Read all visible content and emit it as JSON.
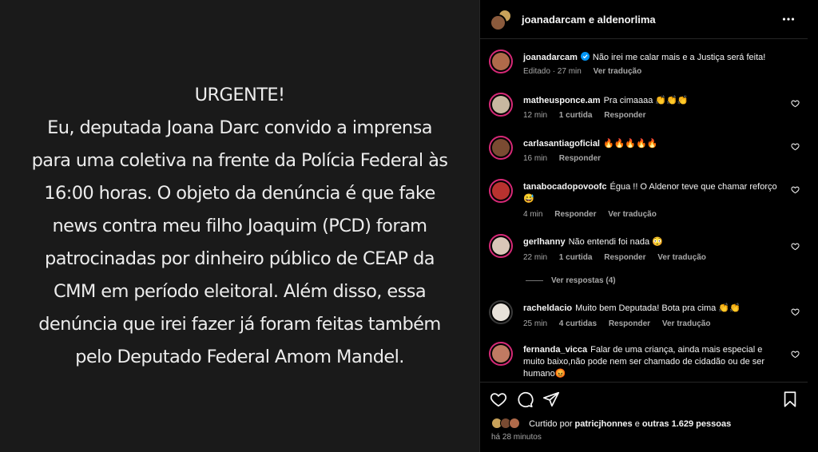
{
  "post": {
    "lines": [
      "URGENTE!",
      "Eu, deputada Joana Darc convido a imprensa",
      "para uma coletiva na frente da Polícia Federal às",
      "16:00 horas. O objeto da denúncia é que fake",
      "news contra meu filho Joaquim (PCD) foram",
      "patrocinadas por dinheiro público de CEAP da",
      "CMM em período eleitoral. Além disso, essa",
      "denúncia que irei fazer já foram feitas também",
      "pelo Deputado Federal Amom Mandel."
    ]
  },
  "header": {
    "title": "joanadarcam e aldenorlima",
    "more_icon": "more-horizontal-icon"
  },
  "caption": {
    "user": "joanadarcam",
    "text": "Não irei me calar mais e a Justiça será feita!",
    "edited": "Editado · 27 min",
    "translate": "Ver tradução"
  },
  "comments": [
    {
      "user": "matheusponce.am",
      "text": "Pra cimaaaa 👏👏👏",
      "time": "12 min",
      "likes": "1 curtida",
      "reply": "Responder",
      "translate": ""
    },
    {
      "user": "carlasantiagoficial",
      "text": "🔥🔥🔥🔥🔥",
      "time": "16 min",
      "likes": "",
      "reply": "Responder",
      "translate": ""
    },
    {
      "user": "tanabocadopovoofc",
      "text": "Égua !! O Aldenor teve que chamar reforço 😅",
      "time": "4 min",
      "likes": "",
      "reply": "Responder",
      "translate": "Ver tradução"
    },
    {
      "user": "gerlhanny",
      "text": "Não entendi foi nada 😳",
      "time": "22 min",
      "likes": "1 curtida",
      "reply": "Responder",
      "translate": "Ver tradução"
    },
    {
      "user": "racheldacio",
      "text": "Muito bem Deputada! Bota pra cima 👏👏",
      "time": "25 min",
      "likes": "4 curtidas",
      "reply": "Responder",
      "translate": "Ver tradução"
    },
    {
      "user": "fernanda_vicca",
      "text": "Falar de uma criança, ainda mais especial e muito baixo,não pode nem ser chamado de cidadão ou de ser humano😡",
      "time": "",
      "likes": "",
      "reply": "",
      "translate": ""
    }
  ],
  "view_replies": "Ver respostas (4)",
  "likes": {
    "prefix": "Curtido por",
    "user": "patricjhonnes",
    "mid": "e",
    "others": "outras 1.629 pessoas"
  },
  "time_ago": "há 28 minutos",
  "icons": {
    "like": "heart-icon",
    "comment": "comment-icon",
    "share": "share-icon",
    "save": "bookmark-icon"
  },
  "colors": {
    "background": "#000000",
    "post_bg": "#1a1a1a",
    "muted": "#a8a8a8",
    "story_ring": "#d62976",
    "verified": "#0095f6"
  }
}
